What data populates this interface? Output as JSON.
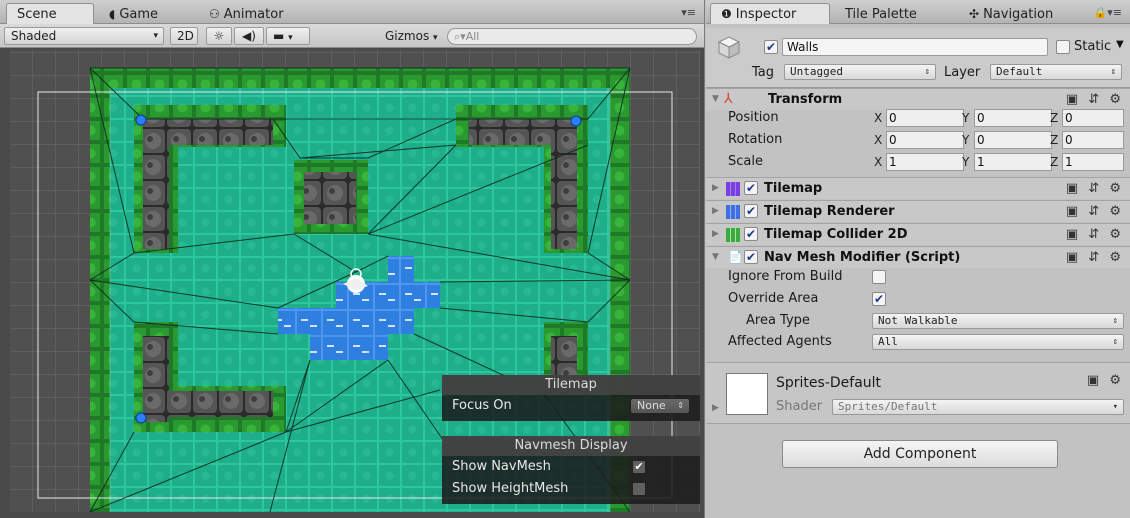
{
  "scene": {
    "tabs": [
      {
        "label": "Scene",
        "icon": "scene-icon"
      },
      {
        "label": "Game",
        "icon": "game-pacman-icon"
      },
      {
        "label": "Animator",
        "icon": "animator-icon"
      }
    ],
    "toolbar": {
      "shading_mode": "Shaded",
      "mode_2d": "2D",
      "gizmos": "Gizmos",
      "search_placeholder": "All"
    },
    "tilemap_overlay": {
      "title": "Tilemap",
      "focus_on_label": "Focus On",
      "focus_on_value": "None"
    },
    "navmesh_overlay": {
      "title": "Navmesh Display",
      "show_navmesh_label": "Show NavMesh",
      "show_navmesh_checked": true,
      "show_heightmesh_label": "Show HeightMesh",
      "show_heightmesh_checked": false
    }
  },
  "inspector": {
    "tabs": [
      {
        "label": "Inspector",
        "icon": "info-icon"
      },
      {
        "label": "Tile Palette",
        "icon": ""
      },
      {
        "label": "Navigation",
        "icon": "navigation-icon"
      }
    ],
    "object": {
      "active": true,
      "name": "Walls",
      "static_label": "Static",
      "static_checked": false,
      "tag_label": "Tag",
      "tag_value": "Untagged",
      "layer_label": "Layer",
      "layer_value": "Default"
    },
    "transform": {
      "title": "Transform",
      "rows": [
        {
          "label": "Position",
          "x": "0",
          "y": "0",
          "z": "0"
        },
        {
          "label": "Rotation",
          "x": "0",
          "y": "0",
          "z": "0"
        },
        {
          "label": "Scale",
          "x": "1",
          "y": "1",
          "z": "1"
        }
      ],
      "axis_labels": [
        "X",
        "Y",
        "Z"
      ]
    },
    "components": [
      {
        "title": "Tilemap",
        "enabled": true
      },
      {
        "title": "Tilemap Renderer",
        "enabled": true
      },
      {
        "title": "Tilemap Collider 2D",
        "enabled": true
      }
    ],
    "nav_mesh_modifier": {
      "title": "Nav Mesh Modifier (Script)",
      "enabled": true,
      "ignore_from_build_label": "Ignore From Build",
      "ignore_from_build": false,
      "override_area_label": "Override Area",
      "override_area": true,
      "area_type_label": "Area Type",
      "area_type_value": "Not Walkable",
      "affected_agents_label": "Affected Agents",
      "affected_agents_value": "All"
    },
    "material": {
      "name": "Sprites-Default",
      "shader_label": "Shader",
      "shader_value": "Sprites/Default"
    },
    "add_component_label": "Add Component"
  },
  "colors": {
    "grass": "#1f8a2c",
    "walkable": "#1fae8a",
    "water": "#2e7fe0",
    "wall": "#3a3a3a",
    "panel": "#c2c2c2"
  }
}
